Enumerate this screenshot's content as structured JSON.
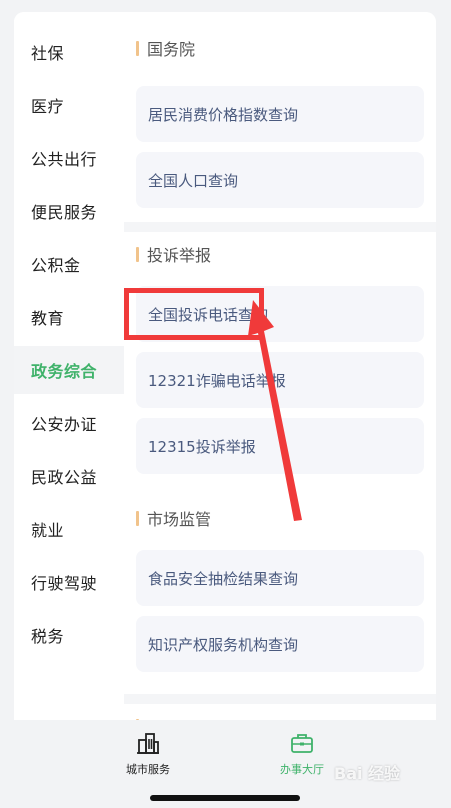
{
  "sidebar": {
    "items": [
      {
        "label": "社保"
      },
      {
        "label": "医疗"
      },
      {
        "label": "公共出行"
      },
      {
        "label": "便民服务"
      },
      {
        "label": "公积金"
      },
      {
        "label": "教育"
      },
      {
        "label": "政务综合",
        "active": true
      },
      {
        "label": "公安办证"
      },
      {
        "label": "民政公益"
      },
      {
        "label": "就业"
      },
      {
        "label": "行驶驾驶"
      },
      {
        "label": "税务"
      }
    ]
  },
  "sections": [
    {
      "title": "国务院",
      "items": [
        "居民消费价格指数查询",
        "全国人口查询"
      ]
    },
    {
      "title": "投诉举报",
      "items": [
        "全国投诉电话查询",
        "12321诈骗电话举报",
        "12315投诉举报"
      ]
    },
    {
      "title": "市场监管",
      "items": [
        "食品安全抽检结果查询",
        "知识产权服务机构查询"
      ]
    }
  ],
  "tabbar": {
    "city": "城市服务",
    "hall": "办事大厅"
  },
  "watermark": "Bai 经验",
  "colors": {
    "accent": "#3fb26a",
    "annotation": "#f03a3a",
    "section_bar": "#f1c38b"
  }
}
